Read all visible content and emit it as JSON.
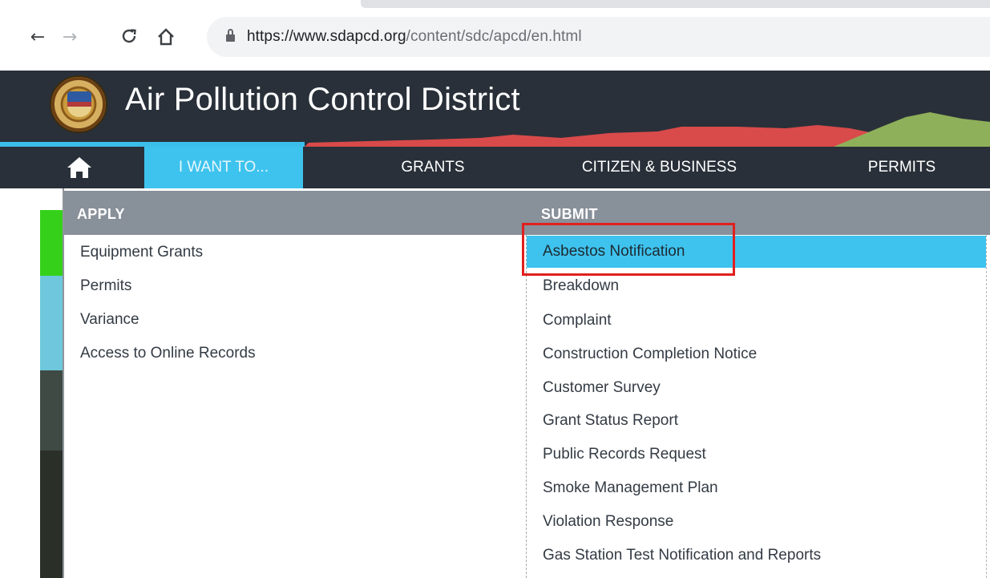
{
  "browser": {
    "url_host": "https://www.sdapcd.org",
    "url_path": "/content/sdc/apcd/en.html"
  },
  "site": {
    "title": "Air Pollution Control District"
  },
  "nav": {
    "items": [
      {
        "label": "I WANT TO...",
        "active": true
      },
      {
        "label": "GRANTS",
        "active": false
      },
      {
        "label": "CITIZEN & BUSINESS",
        "active": false
      },
      {
        "label": "PERMITS",
        "active": false
      }
    ]
  },
  "menu": {
    "apply": {
      "title": "APPLY",
      "links": [
        "Equipment Grants",
        "Permits",
        "Variance",
        "Access to Online Records"
      ]
    },
    "submit": {
      "title": "SUBMIT",
      "links": [
        "Asbestos Notification",
        "Breakdown",
        "Complaint",
        "Construction Completion Notice",
        "Customer Survey",
        "Grant Status Report",
        "Public Records Request",
        "Smoke Management Plan",
        "Violation Response",
        "Gas Station Test Notification and Reports"
      ],
      "highlighted_index": 0
    }
  },
  "colors": {
    "header_bg": "#293039",
    "accent_blue": "#3ec3ee",
    "menu_header_bg": "#88909a",
    "annotation_red": "#e0201e"
  }
}
